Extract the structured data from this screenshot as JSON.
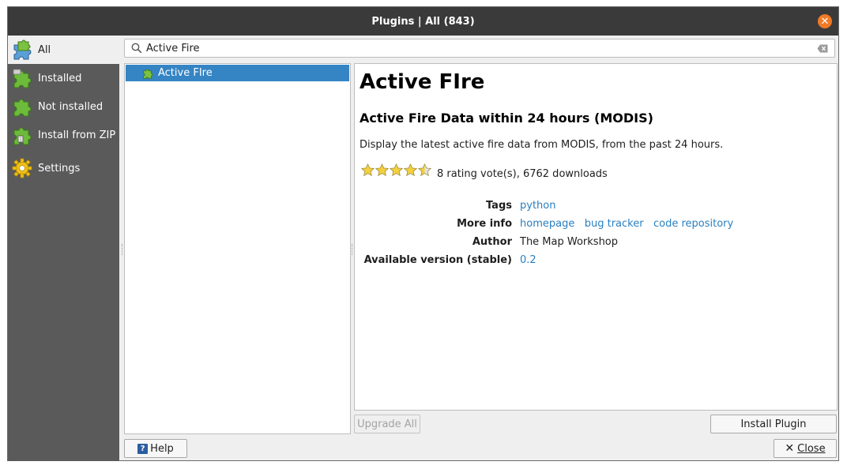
{
  "window": {
    "title": "Plugins | All (843)"
  },
  "sidebar": {
    "items": [
      {
        "label": "All",
        "icon": "plugins-all-icon",
        "active": true
      },
      {
        "label": "Installed",
        "icon": "plugin-installed-icon"
      },
      {
        "label": "Not installed",
        "icon": "plugin-not-installed-icon"
      },
      {
        "label": "Install from ZIP",
        "icon": "plugin-zip-icon"
      },
      {
        "label": "Settings",
        "icon": "gear-icon"
      }
    ]
  },
  "search": {
    "value": "Active Fire"
  },
  "plugin_list": [
    {
      "label": "Active FIre",
      "selected": true
    }
  ],
  "details": {
    "title": "Active FIre",
    "subtitle": "Active Fire Data within 24 hours (MODIS)",
    "description": "Display the latest active fire data from MODIS, from the past 24 hours.",
    "rating_stars": 4.5,
    "rating_text": "8 rating vote(s), 6762 downloads",
    "tags_label": "Tags",
    "tags_value": "python",
    "more_info_label": "More info",
    "links": {
      "homepage": "homepage",
      "bug_tracker": "bug tracker",
      "code_repository": "code repository"
    },
    "author_label": "Author",
    "author_value": "The Map Workshop",
    "version_label": "Available version (stable)",
    "version_value": "0.2"
  },
  "buttons": {
    "upgrade_all": "Upgrade All",
    "install_plugin": "Install Plugin",
    "help": "Help",
    "close": "Close"
  },
  "colors": {
    "accent": "#3584c4",
    "link": "#2a7fc0",
    "sidebar": "#5a5a5a",
    "titlebar": "#3a3a3a",
    "close": "#f07a26"
  }
}
